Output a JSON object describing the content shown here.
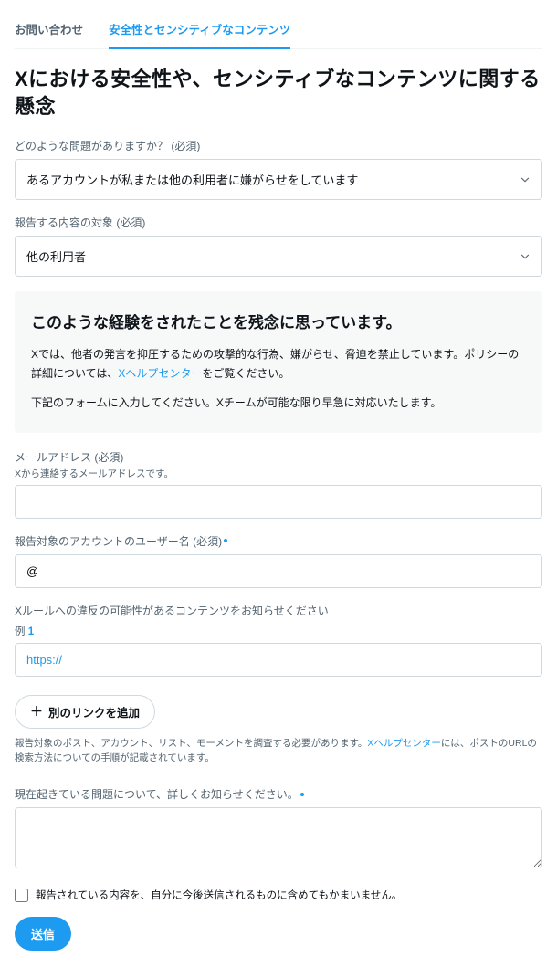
{
  "tabs": {
    "contact": "お問い合わせ",
    "safety": "安全性とセンシティブなコンテンツ"
  },
  "page_title": "Xにおける安全性や、センシティブなコンテンツに関する懸念",
  "question1": {
    "label": "どのような問題がありますか？ (必須)",
    "selected": "あるアカウントが私または他の利用者に嫌がらせをしています"
  },
  "question2": {
    "label": "報告する内容の対象 (必須)",
    "selected": "他の利用者"
  },
  "info": {
    "heading": "このような経験をされたことを残念に思っています。",
    "p1_a": "Xでは、他者の発言を抑圧するための攻撃的な行為、嫌がらせ、脅迫を禁止しています。ポリシーの詳細については、",
    "p1_link": "Xヘルプセンター",
    "p1_b": "をご覧ください。",
    "p2": "下記のフォームに入力してください。Xチームが可能な限り早急に対応いたします。"
  },
  "email": {
    "label": "メールアドレス (必須)",
    "sublabel": "Xから連絡するメールアドレスです。"
  },
  "reported_user": {
    "label": "報告対象のアカウントのユーザー名 (必須)",
    "value": "@"
  },
  "violation": {
    "label": "Xルールへの違反の可能性があるコンテンツをお知らせください",
    "example_prefix": "例",
    "example_num": "1",
    "url_placeholder": "https://"
  },
  "add_link_label": "別のリンクを追加",
  "helper": {
    "a": "報告対象のポスト、アカウント、リスト、モーメントを調査する必要があります。",
    "link": "Xヘルプセンター",
    "b": "には、ポストのURLの検索方法についての手順が記載されています。"
  },
  "details": {
    "label": "現在起きている問題について、詳しくお知らせください。"
  },
  "checkbox_label": "報告されている内容を、自分に今後送信されるものに含めてもかまいません。",
  "submit_label": "送信"
}
